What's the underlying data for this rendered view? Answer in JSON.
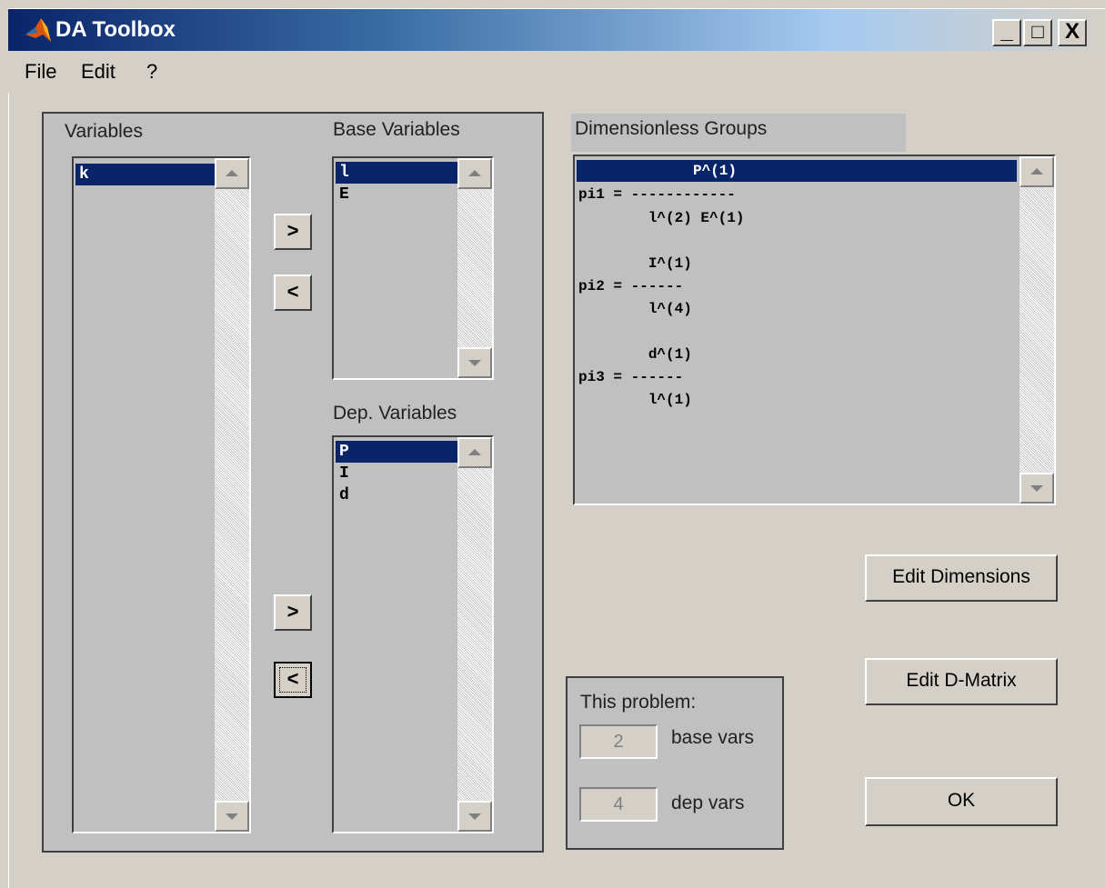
{
  "window": {
    "title": "DA Toolbox",
    "minimize": "_",
    "maximize": "□",
    "close": "X"
  },
  "menu": {
    "items": [
      "File",
      "Edit",
      "?"
    ]
  },
  "variables": {
    "label": "Variables",
    "items": [
      "k"
    ]
  },
  "base_variables": {
    "label": "Base Variables",
    "items": [
      "l",
      "E"
    ]
  },
  "dep_variables": {
    "label": "Dep. Variables",
    "items": [
      "P",
      "I",
      "d"
    ]
  },
  "move_buttons": {
    "base_add": ">",
    "base_remove": "<",
    "dep_add": ">",
    "dep_remove": "<"
  },
  "dimensionless_groups": {
    "label": "Dimensionless Groups",
    "lines": [
      "P^(1)",
      "pi1 = ------------",
      "        l^(2) E^(1)",
      "",
      "        I^(1)",
      "pi2 = ------",
      "        l^(4)",
      "",
      "        d^(1)",
      "pi3 = ------",
      "        l^(1)"
    ]
  },
  "problem": {
    "label": "This problem:",
    "base_count": "2",
    "base_label": "base vars",
    "dep_count": "4",
    "dep_label": "dep vars"
  },
  "buttons": {
    "edit_dimensions": "Edit Dimensions",
    "edit_dmatrix": "Edit D-Matrix",
    "ok": "OK"
  },
  "colors": {
    "selection": "#0a246a",
    "face": "#d4d0c8",
    "panel": "#c0c0c0"
  }
}
